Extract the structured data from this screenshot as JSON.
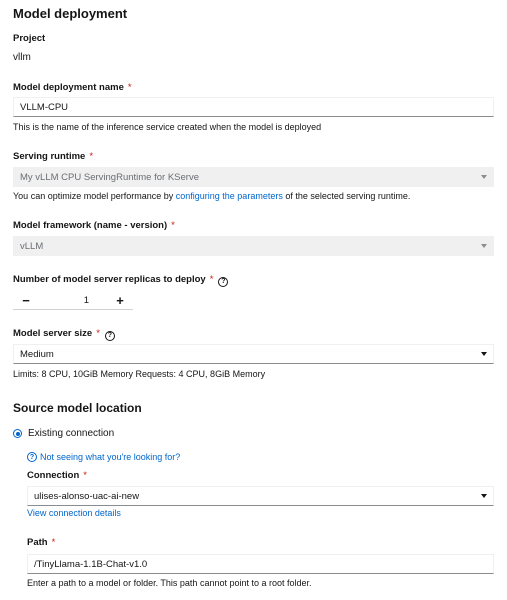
{
  "header": {
    "title": "Model deployment"
  },
  "project": {
    "label": "Project",
    "value": "vllm"
  },
  "deployment_name": {
    "label": "Model deployment name",
    "required": "*",
    "value": "VLLM-CPU",
    "helper": "This is the name of the inference service created when the model is deployed"
  },
  "serving_runtime": {
    "label": "Serving runtime",
    "required": "*",
    "value": "My vLLM CPU ServingRuntime for KServe",
    "helper_before": "You can optimize model performance by ",
    "helper_link": "configuring the parameters",
    "helper_after": " of the selected serving runtime."
  },
  "model_framework": {
    "label": "Model framework (name - version)",
    "required": "*",
    "value": "vLLM"
  },
  "replicas": {
    "label": "Number of model server replicas to deploy",
    "required": "*",
    "value": "1",
    "minus": "−",
    "plus": "+"
  },
  "server_size": {
    "label": "Model server size",
    "required": "*",
    "value": "Medium",
    "helper": "Limits: 8 CPU, 10GiB Memory Requests: 4 CPU, 8GiB Memory"
  },
  "source": {
    "title": "Source model location",
    "radio_label": "Existing connection",
    "help_link": "Not seeing what you're looking for?",
    "connection_label": "Connection",
    "connection_required": "*",
    "connection_value": "ulises-alonso-uac-ai-new",
    "view_details": "View connection details",
    "path_label": "Path",
    "path_required": "*",
    "path_value": "/TinyLlama-1.1B-Chat-v1.0",
    "path_helper": "Enter a path to a model or folder. This path cannot point to a root folder."
  },
  "colors": {
    "link": "#0066cc",
    "required": "#c9190b",
    "disabled_bg": "#f0f0f0"
  },
  "icons": {
    "help": "help-circle-icon",
    "caret": "caret-down-icon",
    "radio": "radio-selected-icon"
  }
}
